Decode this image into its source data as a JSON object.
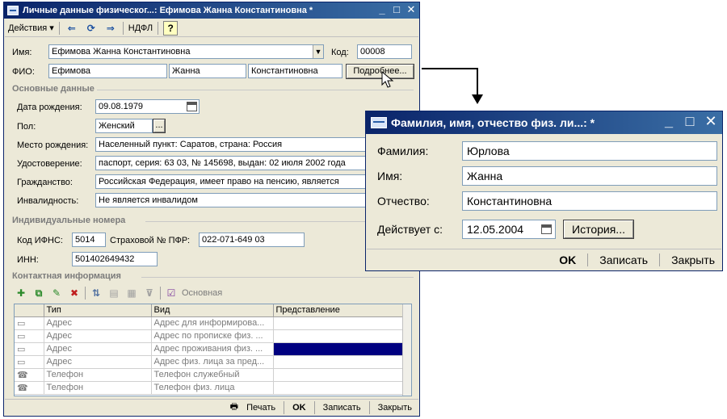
{
  "main_window": {
    "title": "Личные данные физическог...: Ефимова Жанна Константиновна *",
    "menu": {
      "actions": "Действия ▾",
      "ndfl": "НДФЛ",
      "help": "?"
    },
    "name_label": "Имя:",
    "name_value": "Ефимова Жанна Константиновна",
    "code_label": "Код:",
    "code_value": "00008",
    "fio_label": "ФИО:",
    "fio_last": "Ефимова",
    "fio_first": "Жанна",
    "fio_middle": "Константиновна",
    "details_button": "Подробнее...",
    "basic_section": "Основные данные",
    "birth_label": "Дата рождения:",
    "birth_value": "09.08.1979",
    "gender_label": "Пол:",
    "gender_value": "Женский",
    "birthplace_label": "Место рождения:",
    "birthplace_value": "Населенный пункт: Саратов, страна: Россия",
    "id_label": "Удостоверение:",
    "id_value": "паспорт, серия: 63 03, № 145698, выдан: 02 июля 2002 года",
    "citizenship_label": "Гражданство:",
    "citizenship_value": "Российская Федерация, имеет право на пенсию, является",
    "disability_label": "Инвалидность:",
    "disability_value": "Не является инвалидом",
    "numbers_section": "Индивидуальные номера",
    "ifns_label": "Код ИФНС:",
    "ifns_value": "5014",
    "pfr_label": "Страховой № ПФР:",
    "pfr_value": "022-071-649 03",
    "inn_label": "ИНН:",
    "inn_value": "501402649432",
    "contacts_section": "Контактная информация",
    "contacts_toolbar_main": "Основная",
    "grid": {
      "headers": [
        "Тип",
        "Вид",
        "Представление"
      ],
      "rows": [
        {
          "type": "Адрес",
          "kind": "Адрес для информирова...",
          "repr": ""
        },
        {
          "type": "Адрес",
          "kind": "Адрес по прописке физ. ...",
          "repr": ""
        },
        {
          "type": "Адрес",
          "kind": "Адрес проживания физ. ...",
          "repr": ""
        },
        {
          "type": "Адрес",
          "kind": "Адрес физ. лица за пред...",
          "repr": ""
        },
        {
          "type": "Телефон",
          "kind": "Телефон служебный",
          "repr": ""
        },
        {
          "type": "Телефон",
          "kind": "Телефон физ. лица",
          "repr": ""
        }
      ]
    },
    "status": {
      "print": "Печать",
      "ok": "OK",
      "save": "Записать",
      "close": "Закрыть"
    }
  },
  "fio_window": {
    "title": "Фамилия, имя, отчество физ. ли...: *",
    "last_label": "Фамилия:",
    "last_value": "Юрлова",
    "first_label": "Имя:",
    "first_value": "Жанна",
    "middle_label": "Отчество:",
    "middle_value": "Константиновна",
    "valid_label": "Действует с:",
    "valid_value": "12.05.2004",
    "history_button": "История...",
    "status": {
      "ok": "OK",
      "save": "Записать",
      "close": "Закрыть"
    }
  },
  "colors": {
    "title_dark": "#0a246a",
    "title_light": "#3a6ea5",
    "face": "#ece9d8",
    "selection": "#000080"
  }
}
